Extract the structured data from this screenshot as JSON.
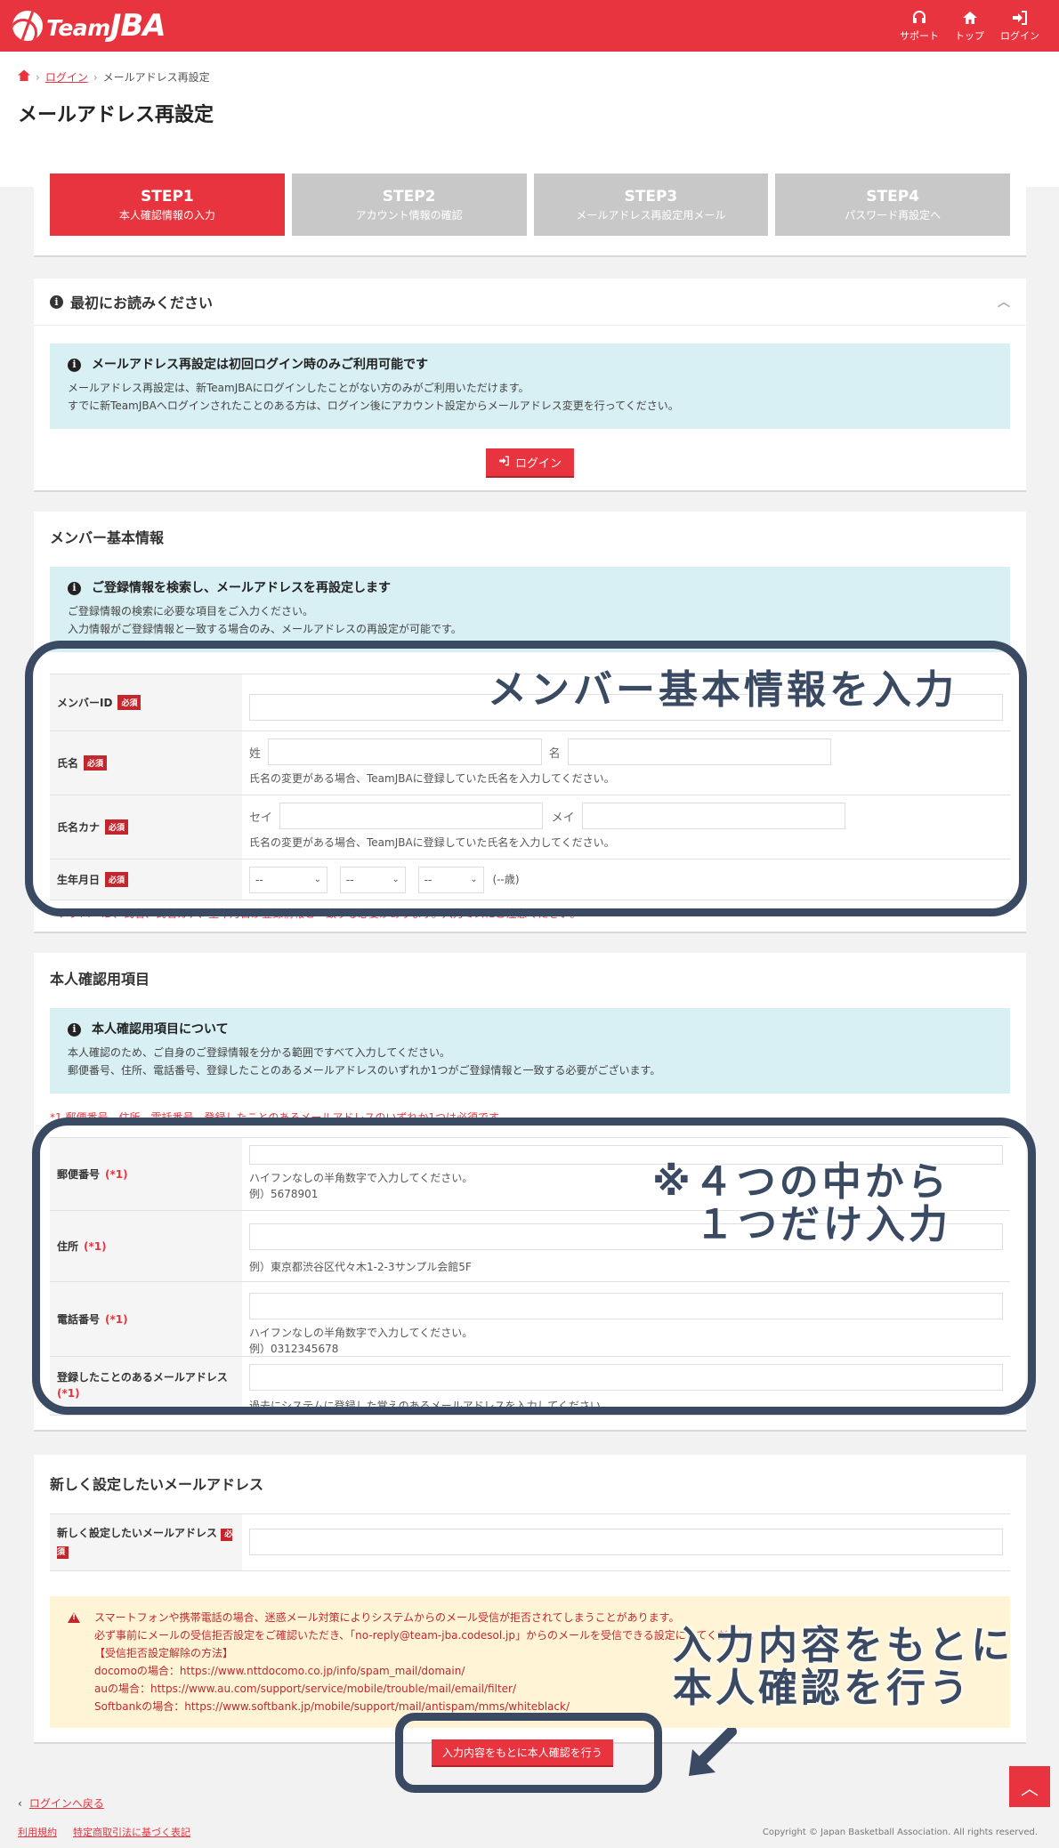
{
  "header": {
    "logo_prefix": "Team",
    "logo_main": "JBA",
    "nav": [
      {
        "label": "サポート",
        "icon": "headset-icon"
      },
      {
        "label": "トップ",
        "icon": "home-icon"
      },
      {
        "label": "ログイン",
        "icon": "login-icon"
      }
    ]
  },
  "breadcrumb": {
    "login": "ログイン",
    "current": "メールアドレス再設定"
  },
  "page_title": "メールアドレス再設定",
  "steps": [
    {
      "title": "STEP1",
      "desc": "本人確認情報の入力"
    },
    {
      "title": "STEP2",
      "desc": "アカウント情報の確認"
    },
    {
      "title": "STEP3",
      "desc": "メールアドレス再設定用メール"
    },
    {
      "title": "STEP4",
      "desc": "パスワード再設定へ"
    }
  ],
  "notice": {
    "title": "最初にお読みください",
    "box_title": "メールアドレス再設定は初回ログイン時のみご利用可能です",
    "line1": "メールアドレス再設定は、新TeamJBAにログインしたことがない方のみがご利用いただけます。",
    "line2": "すでに新TeamJBAへログインされたことのある方は、ログイン後にアカウント設定からメールアドレス変更を行ってください。",
    "button": "ログイン"
  },
  "member": {
    "title": "メンバー基本情報",
    "box_title": "ご登録情報を検索し、メールアドレスを再設定します",
    "line1": "ご登録情報の検索に必要な項目をご入力ください。",
    "line2": "入力情報がご登録情報と一致する場合のみ、メールアドレスの再設定が可能です。",
    "required": "必須",
    "id_label": "メンバーID",
    "name_label": "氏名",
    "sei": "姓",
    "mei": "名",
    "name_hint": "氏名の変更がある場合、TeamJBAに登録していた氏名を入力してください。",
    "kana_label": "氏名カナ",
    "sei_kana": "セイ",
    "mei_kana": "メイ",
    "kana_hint": "氏名の変更がある場合、TeamJBAに登録していた氏名を入力してください。",
    "birth_label": "生年月日",
    "select_default": "--",
    "age": "(--歳)",
    "note": "* メンバーID、氏名、氏名カナ、生年月日が登録情報と一致する必要があります。入力ミスにご注意ください。"
  },
  "identity": {
    "title": "本人確認用項目",
    "box_title": "本人確認用項目について",
    "line1": "本人確認のため、ご自身のご登録情報を分かる範囲ですべて入力してください。",
    "line2": "郵便番号、住所、電話番号、登録したことのあるメールアドレスのいずれか1つがご登録情報と一致する必要がございます。",
    "note": "*1 郵便番号、住所、電話番号、登録したことのあるメールアドレスのいずれか1つは必須です。",
    "opt": "(*1)",
    "zip_label": "郵便番号",
    "zip_hint1": "ハイフンなしの半角数字で入力してください。",
    "zip_hint2": "例）5678901",
    "addr_label": "住所",
    "addr_hint": "例）東京都渋谷区代々木1-2-3サンプル会館5F",
    "tel_label": "電話番号",
    "tel_hint1": "ハイフンなしの半角数字で入力してください。",
    "tel_hint2": "例）0312345678",
    "mail_label": "登録したことのあるメールアドレス",
    "mail_hint": "過去にシステムに登録した覚えのあるメールアドレスを入力してください。"
  },
  "newmail": {
    "title": "新しく設定したいメールアドレス",
    "label": "新しく設定したいメールアドレス",
    "warn1": "スマートフォンや携帯電話の場合、迷惑メール対策によりシステムからのメール受信が拒否されてしまうことがあります。",
    "warn2": "必ず事前にメールの受信拒否設定をご確認いただき、「no-reply@team-jba.codesol.jp」からのメールを受信できる設定にしてください。",
    "warn3": "【受信拒否設定解除の方法】",
    "warn4": "docomoの場合：https://www.nttdocomo.co.jp/info/spam_mail/domain/",
    "warn5": "auの場合：https://www.au.com/support/service/mobile/trouble/mail/email/filter/",
    "warn6": "Softbankの場合：https://www.softbank.jp/mobile/support/mail/antispam/mms/whiteblack/"
  },
  "submit": "入力内容をもとに本人確認を行う",
  "overlays": {
    "member": "メンバー基本情報を入力",
    "identity": "※４つの中から\n　１つだけ入力",
    "submit": "入力内容をもとに\n本人確認を行う"
  },
  "footer": {
    "back": "ログインへ戻る",
    "terms": "利用規約",
    "tokusho": "特定商取引法に基づく表記",
    "copyright": "Copyright © Japan Basketball Association. All rights reserved."
  },
  "colors": {
    "brand": "#e8343e",
    "overlay": "#3a4a63",
    "info_bg": "#d8eff3",
    "warn_bg": "#fff5d6"
  }
}
